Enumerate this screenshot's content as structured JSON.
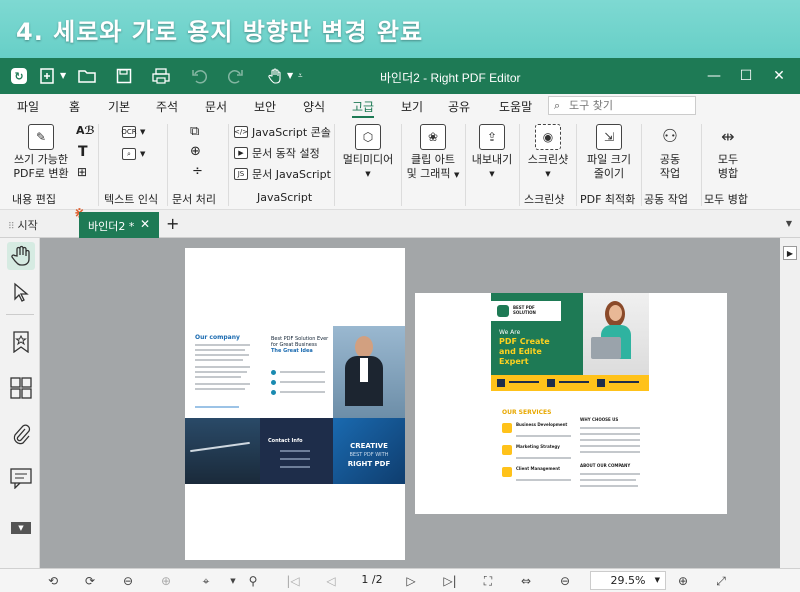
{
  "banner": {
    "title": "4. 세로와 가로 용지 방향만 변경 완료"
  },
  "window": {
    "title": "바인더2 - Right PDF Editor",
    "accent": "#1e7a55"
  },
  "menu": {
    "items": [
      "파일",
      "홈",
      "기본",
      "주석",
      "문서",
      "보안",
      "양식",
      "고급",
      "보기",
      "공유",
      "도움말"
    ],
    "active": "고급"
  },
  "search": {
    "placeholder": "도구 찾기"
  },
  "ribbon": {
    "writable_label_1": "쓰기 가능한",
    "writable_label_2": "PDF로 변환",
    "group_content_edit": "내용 편집",
    "group_text_recognition": "텍스트 인식",
    "group_doc_processing": "문서 처리",
    "js_console": "JavaScript 콘솔",
    "doc_action_settings": "문서 동작 설정",
    "doc_javascript": "문서 JavaScript",
    "group_javascript": "JavaScript",
    "multimedia": "멀티미디어",
    "clipart_1": "클립 아트",
    "clipart_2": "및 그래픽",
    "export": "내보내기",
    "screenshot_btn": "스크린샷",
    "group_screenshot": "스크린샷",
    "shrink_1": "파일 크기",
    "shrink_2": "줄이기",
    "group_pdf_optimize": "PDF 최적화",
    "collab_1": "공동",
    "collab_2": "작업",
    "group_collab": "공동 작업",
    "merge_1": "모두",
    "merge_2": "병합",
    "group_merge": "모두 병합"
  },
  "tabs": {
    "start": "시작",
    "active": "바인더2 *"
  },
  "document": {
    "page1": {
      "company_heading": "Our company",
      "headline": "Best PDF Solution Ever for Great Business",
      "headline_accent": "The Great Idea",
      "contact": "Contact Info",
      "creative": "CREATIVE",
      "best_with": "BEST PDF WITH",
      "right_pdf": "RIGHT PDF"
    },
    "page2": {
      "logo_text": "BEST PDF SOLUTION",
      "we_are": "We Are",
      "pdf_create": "PDF Create",
      "and_edite": "and Edite",
      "expert": "Expert",
      "services": "OUR SERVICES",
      "svc1": "Business Development",
      "svc2": "Marketing Strategy",
      "svc3": "Client Management",
      "why": "WHY CHOOSE US",
      "about": "ABOUT OUR COMPANY"
    }
  },
  "bottom": {
    "page": "1 /2",
    "zoom": "29.5%"
  }
}
